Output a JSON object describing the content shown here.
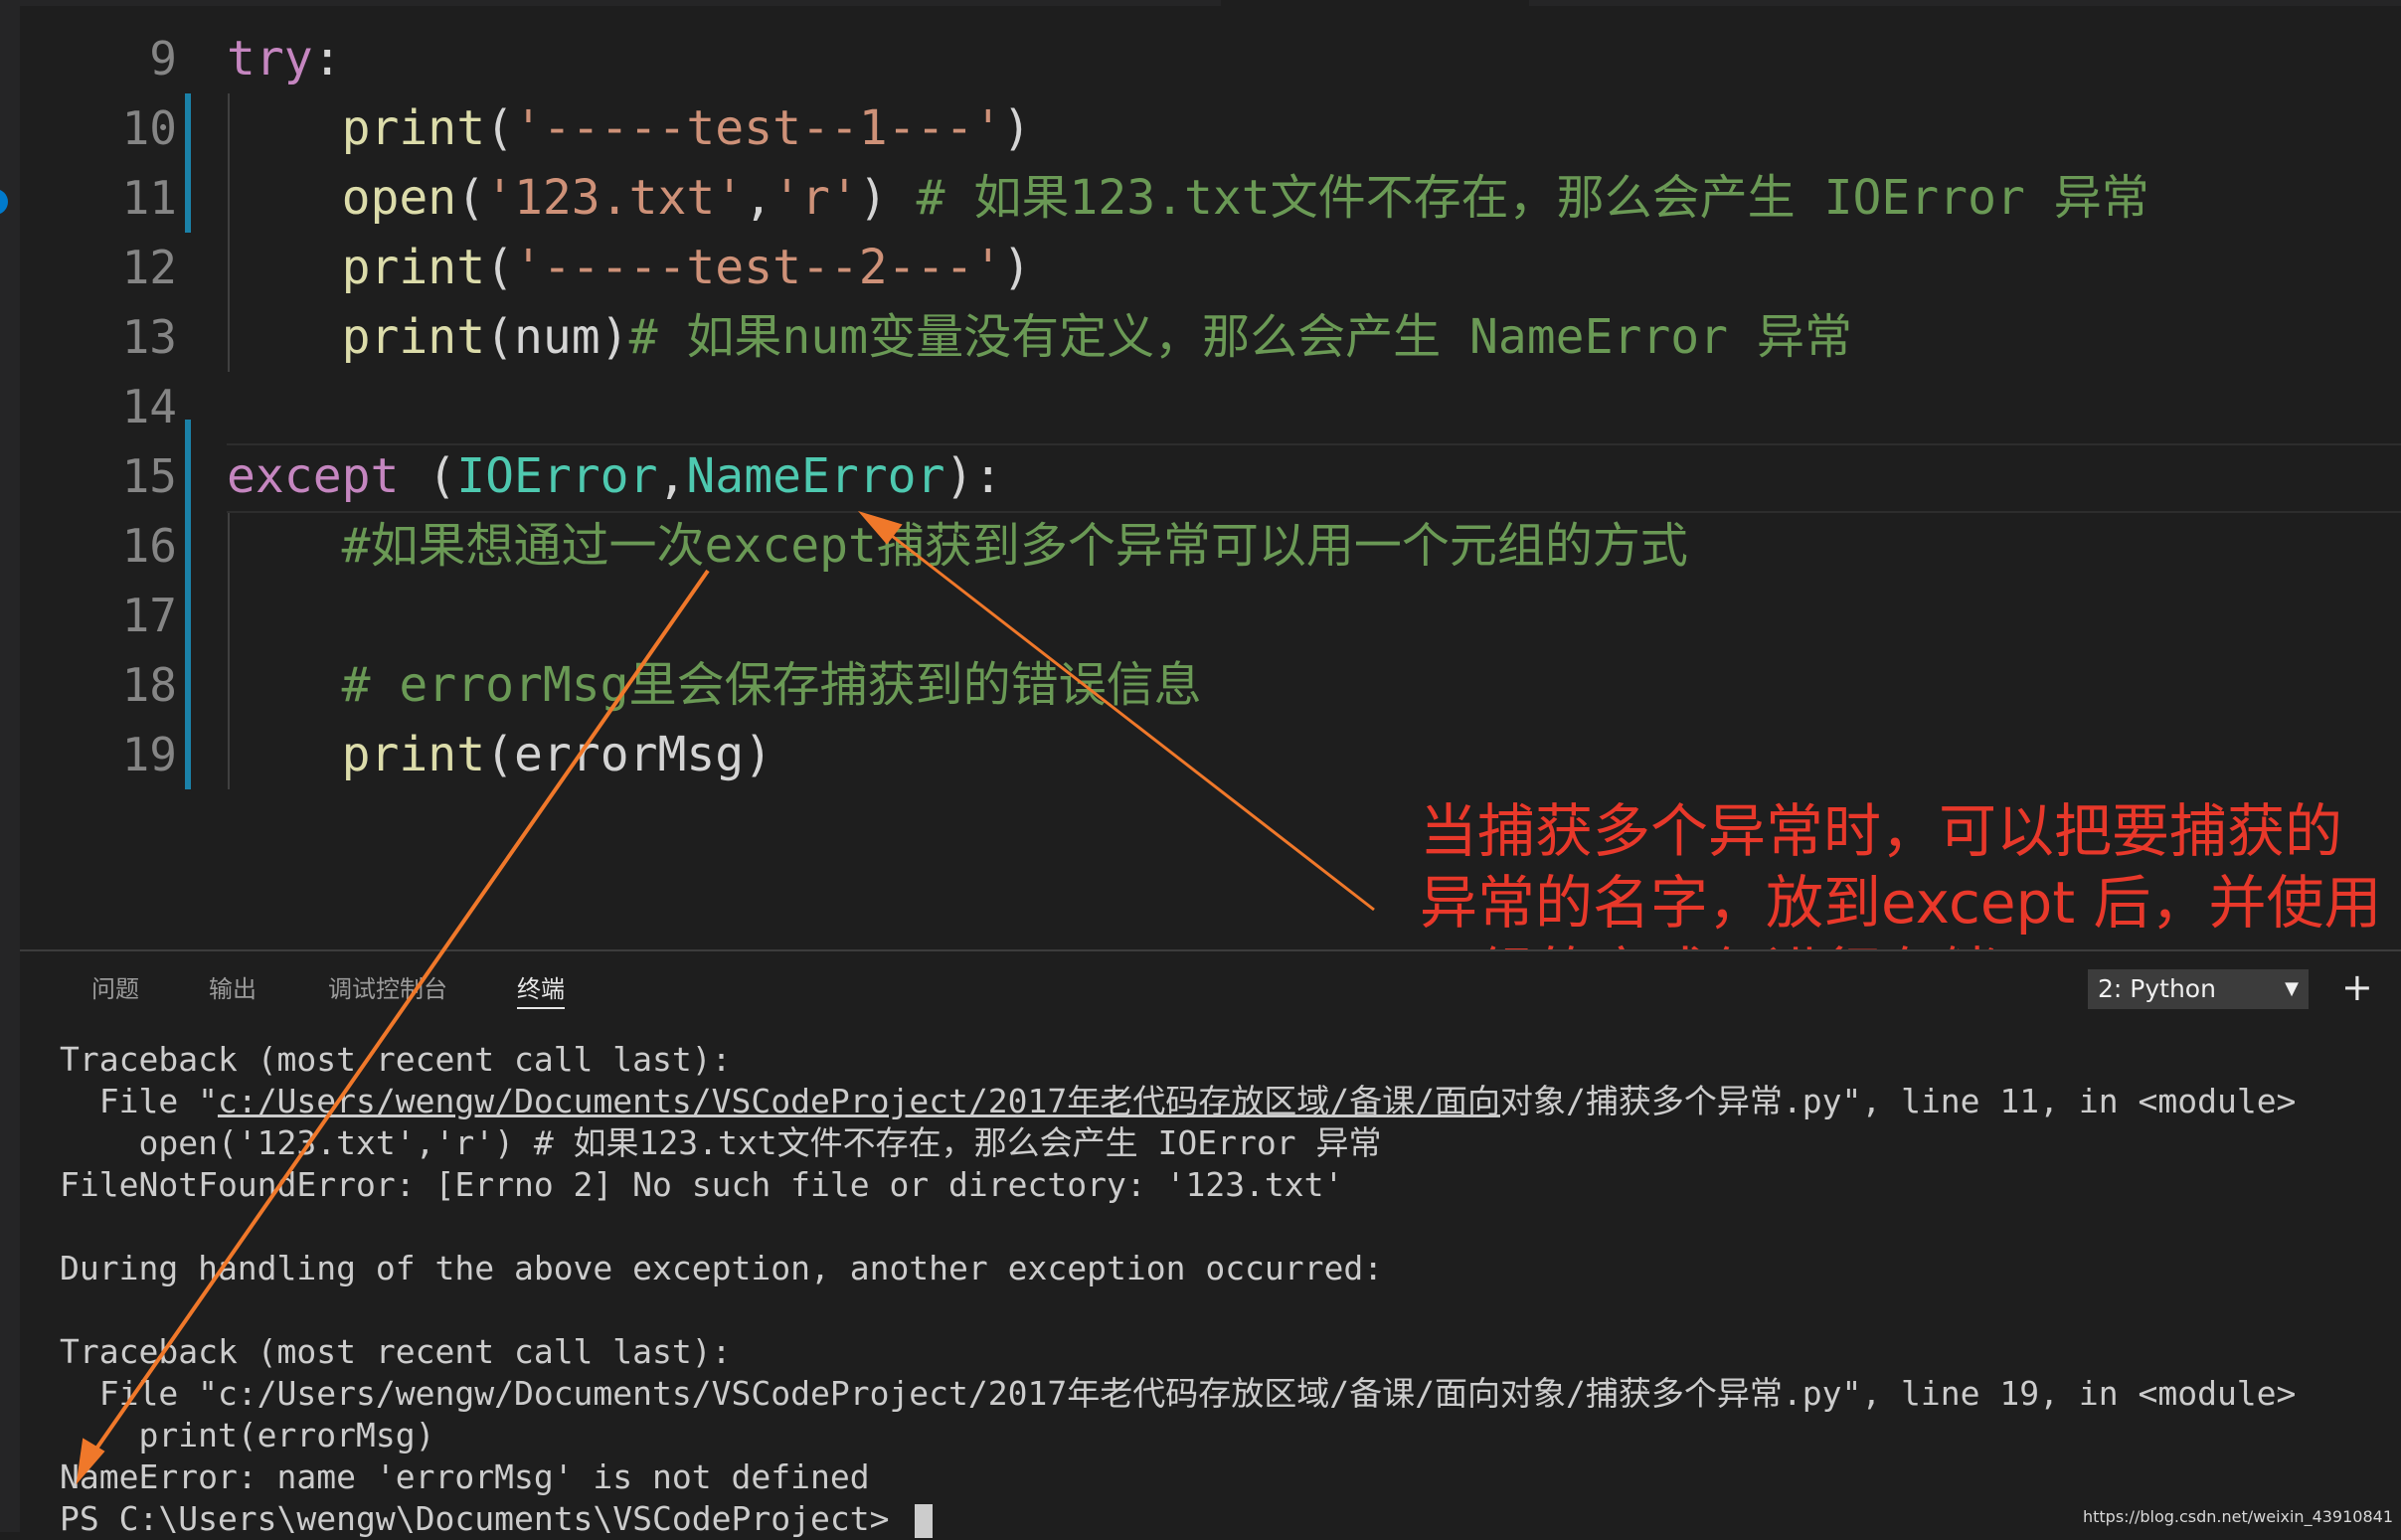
{
  "editor": {
    "lines": [
      {
        "num": "9",
        "tokens": [
          {
            "t": "try",
            "c": "kw"
          },
          {
            "t": ":",
            "c": ""
          }
        ]
      },
      {
        "num": "10",
        "tokens": [
          {
            "t": "    ",
            "c": ""
          },
          {
            "t": "print",
            "c": "fn"
          },
          {
            "t": "(",
            "c": ""
          },
          {
            "t": "'-----test--1---'",
            "c": "str"
          },
          {
            "t": ")",
            "c": ""
          }
        ]
      },
      {
        "num": "11",
        "tokens": [
          {
            "t": "    ",
            "c": ""
          },
          {
            "t": "open",
            "c": "fn"
          },
          {
            "t": "(",
            "c": ""
          },
          {
            "t": "'123.txt'",
            "c": "str"
          },
          {
            "t": ",",
            "c": ""
          },
          {
            "t": "'r'",
            "c": "str"
          },
          {
            "t": ") ",
            "c": ""
          },
          {
            "t": "# 如果123.txt文件不存在，那么会产生 IOError 异常",
            "c": "cmt"
          }
        ]
      },
      {
        "num": "12",
        "tokens": [
          {
            "t": "    ",
            "c": ""
          },
          {
            "t": "print",
            "c": "fn"
          },
          {
            "t": "(",
            "c": ""
          },
          {
            "t": "'-----test--2---'",
            "c": "str"
          },
          {
            "t": ")",
            "c": ""
          }
        ]
      },
      {
        "num": "13",
        "tokens": [
          {
            "t": "    ",
            "c": ""
          },
          {
            "t": "print",
            "c": "fn"
          },
          {
            "t": "(num)",
            "c": ""
          },
          {
            "t": "# 如果num变量没有定义，那么会产生 NameError 异常",
            "c": "cmt"
          }
        ]
      },
      {
        "num": "14",
        "tokens": []
      },
      {
        "num": "15",
        "tokens": [
          {
            "t": "except",
            "c": "kw"
          },
          {
            "t": " (",
            "c": ""
          },
          {
            "t": "IOError",
            "c": "cls"
          },
          {
            "t": ",",
            "c": ""
          },
          {
            "t": "NameError",
            "c": "cls"
          },
          {
            "t": "):",
            "c": ""
          }
        ]
      },
      {
        "num": "16",
        "tokens": [
          {
            "t": "    ",
            "c": ""
          },
          {
            "t": "#如果想通过一次except捕获到多个异常可以用一个元组的方式",
            "c": "cmt"
          }
        ]
      },
      {
        "num": "17",
        "tokens": []
      },
      {
        "num": "18",
        "tokens": [
          {
            "t": "    ",
            "c": ""
          },
          {
            "t": "# errorMsg里会保存捕获到的错误信息",
            "c": "cmt"
          }
        ]
      },
      {
        "num": "19",
        "tokens": [
          {
            "t": "    ",
            "c": ""
          },
          {
            "t": "print",
            "c": "fn"
          },
          {
            "t": "(errorMsg)",
            "c": ""
          }
        ]
      }
    ]
  },
  "annotation": {
    "line1": "当捕获多个异常时，可以把要捕获的",
    "line2": "异常的名字，放到except 后，并使用",
    "line3": "元组的方式仅进行存储",
    "color": "#e8382a"
  },
  "panel": {
    "tabs": [
      "问题",
      "输出",
      "调试控制台",
      "终端"
    ],
    "active_tab": "终端",
    "terminal_select": "2: Python",
    "add_label": "+"
  },
  "terminal": {
    "lines": [
      {
        "text": "Traceback (most recent call last):"
      },
      {
        "pre": "  File \"",
        "link": "c:/Users/wengw/Documents/VSCodeProject/2017年老代码存放区域/备课/面向",
        "post": "对象/捕获多个异常.py\", line 11, in <module>"
      },
      {
        "text": "    open('123.txt','r') # 如果123.txt文件不存在，那么会产生 IOError 异常"
      },
      {
        "text": "FileNotFoundError: [Errno 2] No such file or directory: '123.txt'"
      },
      {
        "text": ""
      },
      {
        "text": "During handling of the above exception, another exception occurred:"
      },
      {
        "text": ""
      },
      {
        "text": "Traceback (most recent call last):"
      },
      {
        "text": "  File \"c:/Users/wengw/Documents/VSCodeProject/2017年老代码存放区域/备课/面向对象/捕获多个异常.py\", line 19, in <module>"
      },
      {
        "text": "    print(errorMsg)"
      },
      {
        "text": "NameError: name 'errorMsg' is not defined"
      },
      {
        "text": "PS C:\\Users\\wengw\\Documents\\VSCodeProject> "
      }
    ]
  },
  "watermark": "https://blog.csdn.net/weixin_43910841",
  "colors": {
    "background": "#1e1e1e",
    "keyword": "#c586c0",
    "function": "#dcdcaa",
    "string": "#ce9178",
    "comment": "#6a9955",
    "class": "#4ec9b0",
    "arrow": "#f0782a"
  }
}
